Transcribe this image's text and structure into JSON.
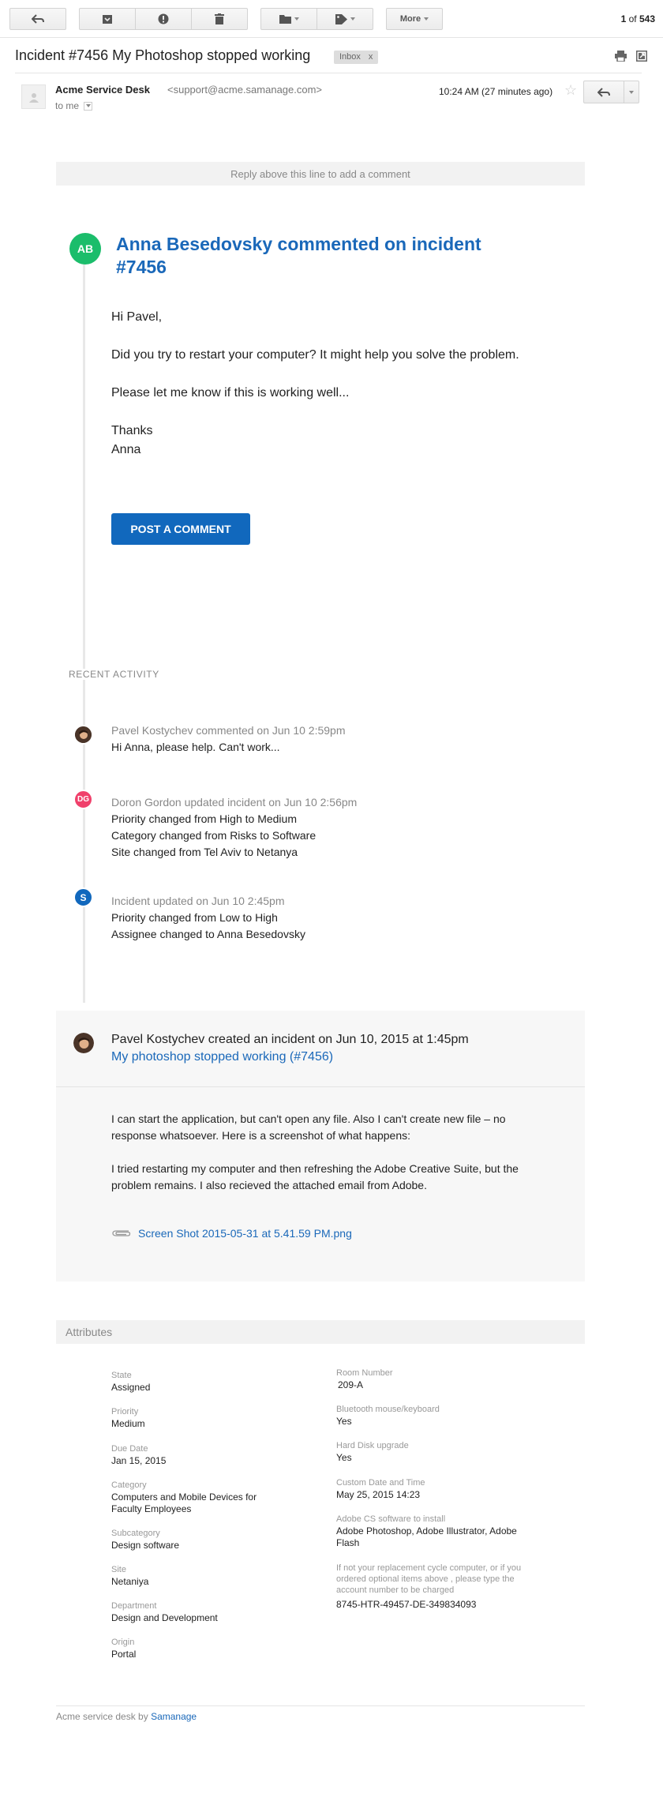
{
  "toolbar": {
    "buttons": [
      "back",
      "archive",
      "report-spam",
      "delete",
      "move-to",
      "labels"
    ],
    "more_label": "More",
    "count_current": "1",
    "count_of": "of",
    "count_total": "543"
  },
  "email": {
    "subject": "Incident #7456 My Photoshop stopped working",
    "label": "Inbox",
    "label_remove": "x",
    "sender_name": "Acme Service Desk",
    "sender_email": "<support@acme.samanage.com>",
    "to": "to me",
    "time": "10:24 AM (27 minutes ago)"
  },
  "body": {
    "reply_line": "Reply above this line to add a comment",
    "commenter_initials": "AB",
    "comment_title": "Anna Besedovsky commented on incident #7456",
    "comment_paragraphs": [
      "Hi Pavel,",
      "Did you try to restart your computer? It might help you solve the problem.",
      "Please let me know if this is working well...",
      "Thanks",
      "Anna"
    ],
    "post_button": "POST A COMMENT"
  },
  "recent": {
    "title": "RECENT ACTIVITY",
    "items": [
      {
        "avatar": "photo",
        "head": "Pavel Kostychev commented on Jun 10 2:59pm",
        "lines": [
          "Hi Anna, please help. Can't work..."
        ]
      },
      {
        "avatar": "DG",
        "head": "Doron Gordon updated incident on Jun 10 2:56pm",
        "lines": [
          "Priority changed from High to Medium",
          "Category changed from Risks to Software",
          "Site changed from Tel Aviv to Netanya"
        ]
      },
      {
        "avatar": "S",
        "head": "Incident updated on Jun 10 2:45pm",
        "lines": [
          "Priority changed from Low to High",
          "Assignee changed to Anna Besedovsky"
        ]
      }
    ]
  },
  "incident": {
    "head": "Pavel Kostychev created an incident on Jun 10, 2015 at 1:45pm",
    "link": "My photoshop stopped working (#7456)",
    "paragraphs": [
      "I can start the application, but can't open any file. Also I can't create new file – no response whatsoever. Here is a screenshot of what happens:",
      "I tried restarting my computer and then refreshing the Adobe Creative Suite, but the problem remains. I also recieved the attached email from Adobe."
    ],
    "attachment": "Screen Shot 2015-05-31 at 5.41.59 PM.png"
  },
  "attributes": {
    "title": "Attributes",
    "left": [
      {
        "label": "State",
        "value": "Assigned"
      },
      {
        "label": "Priority",
        "value": "Medium"
      },
      {
        "label": "Due Date",
        "value": "Jan 15, 2015"
      },
      {
        "label": "Category",
        "value": "Computers and Mobile Devices for Faculty Employees"
      },
      {
        "label": "Subcategory",
        "value": "Design software"
      },
      {
        "label": "Site",
        "value": "Netaniya"
      },
      {
        "label": "Department",
        "value": "Design and Development"
      },
      {
        "label": "Origin",
        "value": "Portal"
      }
    ],
    "right": [
      {
        "label": "Room Number",
        "value": "209-A"
      },
      {
        "label": "Bluetooth mouse/keyboard",
        "value": "Yes"
      },
      {
        "label": "Hard Disk upgrade",
        "value": "Yes"
      },
      {
        "label": "Custom Date and Time",
        "value": "May 25, 2015 14:23"
      },
      {
        "label": "Adobe CS software to install",
        "value": "Adobe Photoshop, Adobe Illustrator, Adobe Flash"
      },
      {
        "label": "If not your replacement cycle computer, or if you ordered optional items above , please type the account number to be charged",
        "value": "8745-HTR-49457-DE-349834093"
      }
    ]
  },
  "footer": {
    "text": "Acme service desk by",
    "link": "Samanage"
  },
  "colors": {
    "accent_blue": "#1a68b9",
    "button_blue": "#1168bd",
    "avatar_ab": "#1bbd6b",
    "avatar_dg": "#f0406b",
    "avatar_s": "#1168bd"
  }
}
